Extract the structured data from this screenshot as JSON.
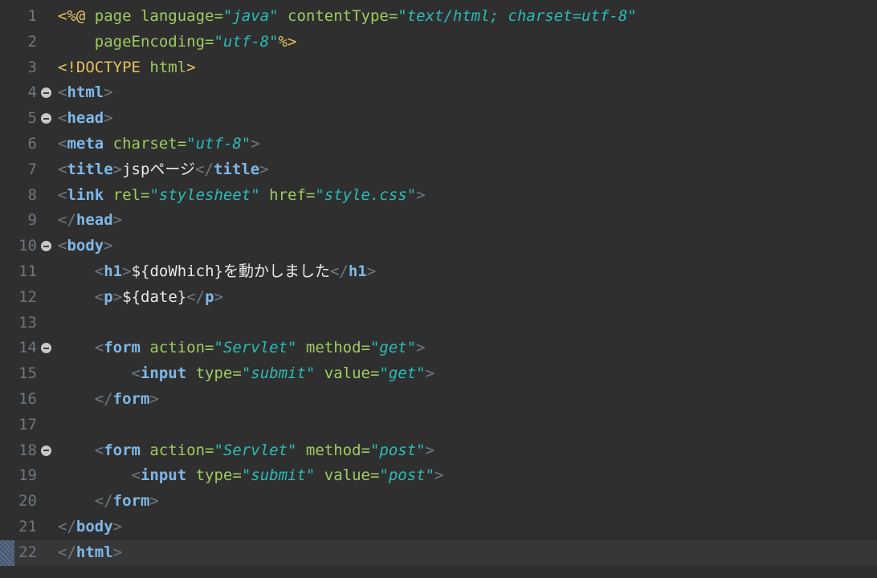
{
  "editor": {
    "language": "jsp",
    "current_line": 22,
    "lines": [
      {
        "num": "1",
        "tokens": [
          {
            "t": "d",
            "s": "<%@ "
          },
          {
            "t": "a",
            "s": "page language="
          },
          {
            "t": "v",
            "s": "\"java\""
          },
          {
            "t": "a",
            "s": " contentType="
          },
          {
            "t": "v",
            "s": "\"text/html; charset=utf-8\""
          }
        ]
      },
      {
        "num": "2",
        "tokens": [
          {
            "t": "a",
            "s": "    pageEncoding="
          },
          {
            "t": "v",
            "s": "\"utf-8\""
          },
          {
            "t": "d",
            "s": "%>"
          }
        ]
      },
      {
        "num": "3",
        "tokens": [
          {
            "t": "d",
            "s": "<!DOCTYPE "
          },
          {
            "t": "a",
            "s": "html"
          },
          {
            "t": "d",
            "s": ">"
          }
        ]
      },
      {
        "num": "4",
        "fold": true,
        "tokens": [
          {
            "t": "p",
            "s": "<"
          },
          {
            "t": "g",
            "s": "html"
          },
          {
            "t": "p",
            "s": ">"
          }
        ]
      },
      {
        "num": "5",
        "fold": true,
        "tokens": [
          {
            "t": "p",
            "s": "<"
          },
          {
            "t": "g",
            "s": "head"
          },
          {
            "t": "p",
            "s": ">"
          }
        ]
      },
      {
        "num": "6",
        "tokens": [
          {
            "t": "p",
            "s": "<"
          },
          {
            "t": "g",
            "s": "meta"
          },
          {
            "t": "a",
            "s": " charset="
          },
          {
            "t": "v",
            "s": "\"utf-8\""
          },
          {
            "t": "p",
            "s": ">"
          }
        ]
      },
      {
        "num": "7",
        "tokens": [
          {
            "t": "p",
            "s": "<"
          },
          {
            "t": "g",
            "s": "title"
          },
          {
            "t": "p",
            "s": ">"
          },
          {
            "t": "t",
            "s": "jspページ"
          },
          {
            "t": "p",
            "s": "</"
          },
          {
            "t": "g",
            "s": "title"
          },
          {
            "t": "p",
            "s": ">"
          }
        ]
      },
      {
        "num": "8",
        "tokens": [
          {
            "t": "p",
            "s": "<"
          },
          {
            "t": "g",
            "s": "link"
          },
          {
            "t": "a",
            "s": " rel="
          },
          {
            "t": "v",
            "s": "\"stylesheet\""
          },
          {
            "t": "a",
            "s": " href="
          },
          {
            "t": "v",
            "s": "\"style.css\""
          },
          {
            "t": "p",
            "s": ">"
          }
        ]
      },
      {
        "num": "9",
        "tokens": [
          {
            "t": "p",
            "s": "</"
          },
          {
            "t": "g",
            "s": "head"
          },
          {
            "t": "p",
            "s": ">"
          }
        ]
      },
      {
        "num": "10",
        "fold": true,
        "tokens": [
          {
            "t": "p",
            "s": "<"
          },
          {
            "t": "g",
            "s": "body"
          },
          {
            "t": "p",
            "s": ">"
          }
        ]
      },
      {
        "num": "11",
        "tokens": [
          {
            "t": "t",
            "s": "    "
          },
          {
            "t": "p",
            "s": "<"
          },
          {
            "t": "g",
            "s": "h1"
          },
          {
            "t": "p",
            "s": ">"
          },
          {
            "t": "t",
            "s": "${doWhich}を動かしました"
          },
          {
            "t": "p",
            "s": "</"
          },
          {
            "t": "g",
            "s": "h1"
          },
          {
            "t": "p",
            "s": ">"
          }
        ]
      },
      {
        "num": "12",
        "tokens": [
          {
            "t": "t",
            "s": "    "
          },
          {
            "t": "p",
            "s": "<"
          },
          {
            "t": "g",
            "s": "p"
          },
          {
            "t": "p",
            "s": ">"
          },
          {
            "t": "t",
            "s": "${date}"
          },
          {
            "t": "p",
            "s": "</"
          },
          {
            "t": "g",
            "s": "p"
          },
          {
            "t": "p",
            "s": ">"
          }
        ]
      },
      {
        "num": "13",
        "tokens": []
      },
      {
        "num": "14",
        "fold": true,
        "tokens": [
          {
            "t": "t",
            "s": "    "
          },
          {
            "t": "p",
            "s": "<"
          },
          {
            "t": "g",
            "s": "form"
          },
          {
            "t": "a",
            "s": " action="
          },
          {
            "t": "v",
            "s": "\"Servlet\""
          },
          {
            "t": "a",
            "s": " method="
          },
          {
            "t": "v",
            "s": "\"get\""
          },
          {
            "t": "p",
            "s": ">"
          }
        ]
      },
      {
        "num": "15",
        "tokens": [
          {
            "t": "t",
            "s": "        "
          },
          {
            "t": "p",
            "s": "<"
          },
          {
            "t": "g",
            "s": "input"
          },
          {
            "t": "a",
            "s": " type="
          },
          {
            "t": "v",
            "s": "\"submit\""
          },
          {
            "t": "a",
            "s": " value="
          },
          {
            "t": "v",
            "s": "\"get\""
          },
          {
            "t": "p",
            "s": ">"
          }
        ]
      },
      {
        "num": "16",
        "tokens": [
          {
            "t": "t",
            "s": "    "
          },
          {
            "t": "p",
            "s": "</"
          },
          {
            "t": "g",
            "s": "form"
          },
          {
            "t": "p",
            "s": ">"
          }
        ]
      },
      {
        "num": "17",
        "tokens": []
      },
      {
        "num": "18",
        "fold": true,
        "tokens": [
          {
            "t": "t",
            "s": "    "
          },
          {
            "t": "p",
            "s": "<"
          },
          {
            "t": "g",
            "s": "form"
          },
          {
            "t": "a",
            "s": " action="
          },
          {
            "t": "v",
            "s": "\"Servlet\""
          },
          {
            "t": "a",
            "s": " method="
          },
          {
            "t": "v",
            "s": "\"post\""
          },
          {
            "t": "p",
            "s": ">"
          }
        ]
      },
      {
        "num": "19",
        "tokens": [
          {
            "t": "t",
            "s": "        "
          },
          {
            "t": "p",
            "s": "<"
          },
          {
            "t": "g",
            "s": "input"
          },
          {
            "t": "a",
            "s": " type="
          },
          {
            "t": "v",
            "s": "\"submit\""
          },
          {
            "t": "a",
            "s": " value="
          },
          {
            "t": "v",
            "s": "\"post\""
          },
          {
            "t": "p",
            "s": ">"
          }
        ]
      },
      {
        "num": "20",
        "tokens": [
          {
            "t": "t",
            "s": "    "
          },
          {
            "t": "p",
            "s": "</"
          },
          {
            "t": "g",
            "s": "form"
          },
          {
            "t": "p",
            "s": ">"
          }
        ]
      },
      {
        "num": "21",
        "tokens": [
          {
            "t": "p",
            "s": "</"
          },
          {
            "t": "g",
            "s": "body"
          },
          {
            "t": "p",
            "s": ">"
          }
        ]
      },
      {
        "num": "22",
        "tokens": [
          {
            "t": "p",
            "s": "</"
          },
          {
            "t": "g",
            "s": "html"
          },
          {
            "t": "p",
            "s": ">"
          }
        ]
      }
    ]
  },
  "colors": {
    "background": "#2f2f2f",
    "current_line": "#373737",
    "line_number": "#6d7780",
    "directive": "#e4c260",
    "attribute": "#9ecb62",
    "attribute_value": "#2bbcb6",
    "tag_name": "#7fb8e8",
    "punctuation": "#6f7a83",
    "text": "#e8e8e8"
  }
}
